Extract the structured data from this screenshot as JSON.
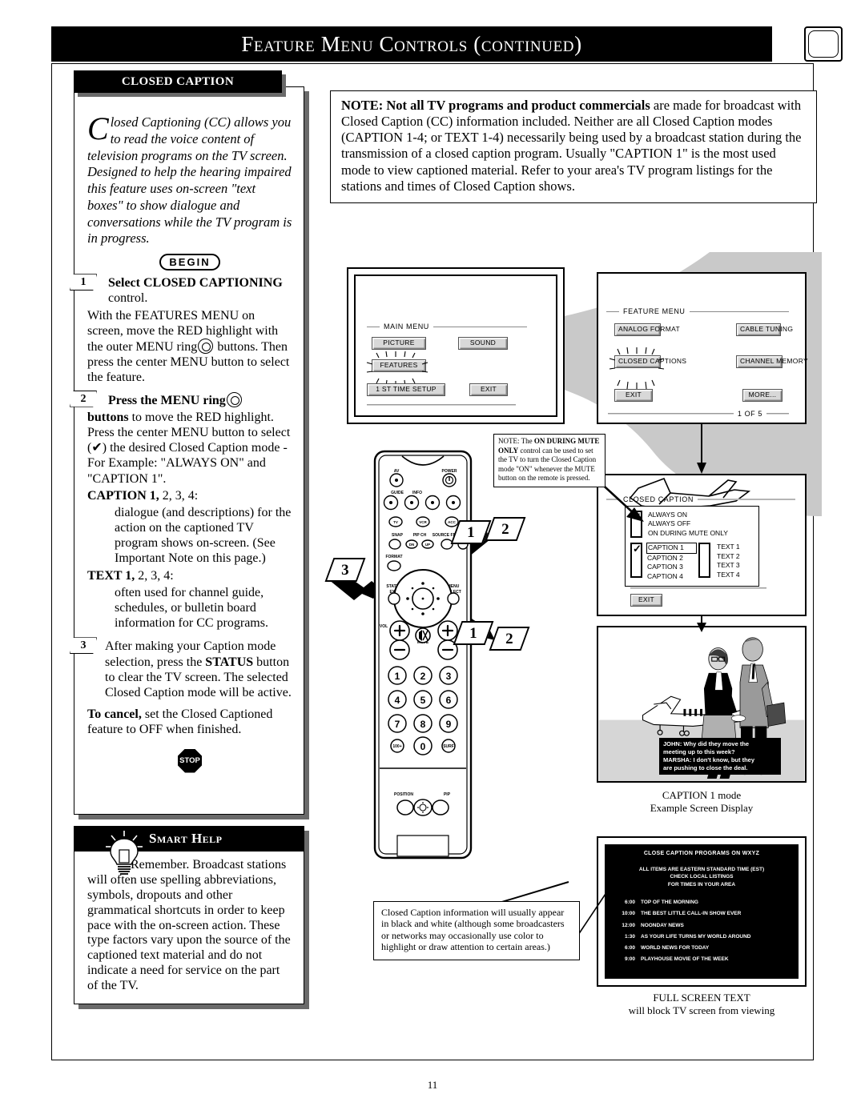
{
  "header": {
    "title": "Feature Menu Controls (continued)",
    "corner_icon": "page-corner-icon"
  },
  "page_number": "11",
  "left_column": {
    "banner_label": "CLOSED CAPTION",
    "intro_dropcap": "C",
    "intro_text": "losed Captioning (CC) allows you to read the voice content of television programs on the TV screen. Designed to help the hearing impaired this feature uses on-screen \"text boxes\" to show dialogue and conversations while the TV program is in progress.",
    "begin_label": "BEGIN",
    "stop_label": "STOP",
    "steps": [
      {
        "num": "1",
        "heading": "Select CLOSED CAPTIONING",
        "heading_tail": " control.",
        "body": "With the FEATURES MENU on screen, move the RED highlight with the outer MENU ring",
        "body2": "buttons. Then press the center MENU button to select the feature."
      },
      {
        "num": "2",
        "heading": "Press the MENU ring",
        "heading_tail": "buttons",
        "body": " to move the RED highlight. Press the center MENU button to select (✔) the desired Closed Caption mode - For Example: \"ALWAYS ON\" and \"CAPTION 1\".",
        "caption_label": "CAPTION 1,",
        "caption_label_tail": " 2, 3, 4:",
        "caption_desc": "dialogue (and descriptions) for the action on the captioned TV program shows on-screen. (See Important Note on this page.)",
        "text_label": "TEXT 1,",
        "text_label_tail": " 2, 3, 4:",
        "text_desc": "often used for channel guide, schedules, or bulletin board information for CC programs."
      },
      {
        "num": "3",
        "body_a": "After making your Caption mode selection, press the ",
        "body_b": "STATUS",
        "body_c": " button to clear the TV screen. The selected Closed Caption mode will be active.",
        "cancel_label": "To cancel,",
        "cancel_text": " set the Closed Captioned feature to OFF when finished."
      }
    ],
    "smart_help": {
      "title": "Smart Help",
      "icon": "lightbulb-icon",
      "text": "Remember.  Broadcast stations will often use spelling abbreviations, symbols, dropouts and other grammatical shortcuts in order to keep pace with the on-screen action. These type factors vary upon the source of the captioned text material and do not indicate a need for service on the part of the TV."
    }
  },
  "note_box": {
    "bold_lead": "NOTE: Not all TV programs and product commercials",
    "text": " are made for broadcast with Closed Caption (CC) information included. Neither are all Closed Caption modes (CAPTION 1-4; or TEXT 1-4) necessarily being used by a broadcast station during the transmission of a closed caption program. Usually \"CAPTION 1\" is the most used mode to view captioned material. Refer to your area's TV program listings for the stations and times of Closed Caption shows."
  },
  "mute_note": {
    "lead": "NOTE: The ",
    "bold1": "ON DURING MUTE ONLY",
    "text": " control can be used to set the TV to turn the Closed Caption mode \"ON\" whenever the MUTE button on the remote is pressed."
  },
  "color_note": {
    "text": "Closed Caption information will usually appear in black and white (although some broadcasters or networks may occasionally use color to highlight or draw attention to certain areas.)"
  },
  "screens": {
    "main_menu": {
      "title": "MAIN MENU",
      "buttons": [
        {
          "label": "PICTURE",
          "highlighted": false
        },
        {
          "label": "SOUND",
          "highlighted": false
        },
        {
          "label": "FEATURES",
          "highlighted": true
        },
        {
          "label": "1 ST TIME SETUP",
          "highlighted": false
        },
        {
          "label": "EXIT",
          "highlighted": false
        }
      ]
    },
    "feature_menu": {
      "title": "FEATURE MENU",
      "buttons": [
        {
          "label": "ANALOG FORMAT",
          "highlighted": false
        },
        {
          "label": "CABLE TUNING",
          "highlighted": false
        },
        {
          "label": "CLOSED CAPTIONS",
          "highlighted": true
        },
        {
          "label": "CHANNEL MEMORY",
          "highlighted": false
        },
        {
          "label": "EXIT",
          "highlighted": false
        },
        {
          "label": "MORE...",
          "highlighted": false
        }
      ],
      "page_indicator": "1  OF 5"
    },
    "closed_caption": {
      "title": "CLOSED CAPTION",
      "mode_options": [
        "ALWAYS ON",
        "ALWAYS OFF",
        "ON  DURING MUTE ONLY"
      ],
      "mode_checked": "ALWAYS ON",
      "caption_options": [
        "CAPTION 1",
        "CAPTION 2",
        "CAPTION 3",
        "CAPTION 4"
      ],
      "caption_checked": "CAPTION 1",
      "text_options": [
        "TEXT 1",
        "TEXT 2",
        "TEXT 3",
        "TEXT 4"
      ],
      "exit_label": "EXIT"
    },
    "example_photo": {
      "caption_lines": [
        "JOHN: Why did they move  the",
        "meeting up to this week?",
        "MARSHA: I don't know, but they",
        "are pushing to close the deal."
      ],
      "label_line1": "CAPTION 1 mode",
      "label_line2": "Example Screen Display"
    },
    "full_screen_text": {
      "title": "CLOSE CAPTION PROGRAMS ON WXYZ",
      "subtitle_lines": [
        "ALL ITEMS ARE EASTERN STANDARD TIME (EST)",
        "CHECK LOCAL LISTINGS",
        "FOR TIMES IN YOUR AREA"
      ],
      "listings": [
        {
          "time": "6:00",
          "program": "TOP OF THE MORNING"
        },
        {
          "time": "10:00",
          "program": "THE BEST LITTLE CALL-IN SHOW EVER"
        },
        {
          "time": "12:00",
          "program": "NOONDAY NEWS"
        },
        {
          "time": "1:30",
          "program": "AS YOUR LIFE TURNS MY WORLD AROUND"
        },
        {
          "time": "6:00",
          "program": "WORLD NEWS FOR TODAY"
        },
        {
          "time": "9:00",
          "program": "PLAYHOUSE MOVIE OF THE WEEK"
        }
      ],
      "label_line1": "FULL SCREEN TEXT",
      "label_line2": "will block TV screen from viewing"
    }
  },
  "remote": {
    "labels": {
      "av": "AV",
      "power": "POWER",
      "guide": "GUIDE",
      "info": "INFO",
      "tv": "TV",
      "vcr": "VCR",
      "acc": "ACC",
      "snap": "SNAP",
      "pip_ch": "PIP CH",
      "pip_dn": "DN",
      "pip_up": "UP",
      "source": "SOURCE FPP",
      "format": "FORMAT",
      "status": "STATUS",
      "exit": "EXIT",
      "menu": "MENU",
      "select": "SELECT",
      "vol": "VOL",
      "mute": "MUTE",
      "position": "POSITION",
      "pip": "PIP",
      "hundred": "100+",
      "surf": "SURF"
    },
    "keypad": [
      "1",
      "2",
      "3",
      "4",
      "5",
      "6",
      "7",
      "8",
      "9",
      "100+",
      "0",
      "SURF"
    ]
  },
  "callouts": [
    {
      "id": "callout-1a",
      "label": "1"
    },
    {
      "id": "callout-2a",
      "label": "2"
    },
    {
      "id": "callout-3",
      "label": "3"
    },
    {
      "id": "callout-1b",
      "label": "1"
    },
    {
      "id": "callout-2b",
      "label": "2"
    }
  ],
  "colors": {
    "ink": "#000000",
    "shadow": "#6a6a6a",
    "osd_button": "#d8d8d8",
    "swoosh": "#c9c9c9",
    "screen_black": "#000000"
  }
}
